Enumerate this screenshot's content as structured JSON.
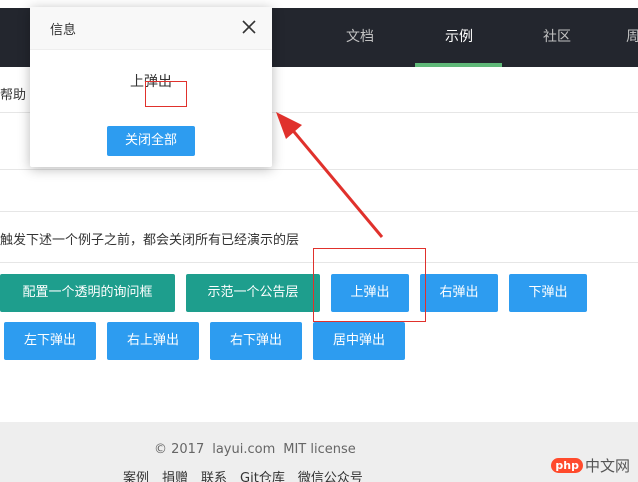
{
  "nav": {
    "items": [
      "文档",
      "示例",
      "社区",
      "周"
    ],
    "active_index": 1,
    "underline_color": "#5fb878"
  },
  "content": {
    "help_text": "帮助",
    "description": "触发下述一个例子之前，都会关闭所有已经演示的层"
  },
  "buttons": {
    "row1": [
      "配置一个透明的询问框",
      "示范一个公告层",
      "上弹出",
      "右弹出",
      "下弹出"
    ],
    "row2": [
      "左下弹出",
      "右上弹出",
      "右下弹出",
      "居中弹出"
    ]
  },
  "dialog": {
    "title": "信息",
    "content": "上弹出",
    "close_all": "关闭全部",
    "close_icon": "close-icon"
  },
  "footer": {
    "copyright": "© 2017",
    "site": "layui.com",
    "license": "MIT license",
    "links": [
      "案例",
      "捐赠",
      "联系",
      "Git仓库",
      "微信公众号"
    ]
  },
  "watermark": {
    "logo": "php",
    "text": "中文网"
  },
  "colors": {
    "nav_bg": "#23262e",
    "teal": "#1e9e8d",
    "blue": "#2d9cf0",
    "annotation": "#e0312c"
  }
}
